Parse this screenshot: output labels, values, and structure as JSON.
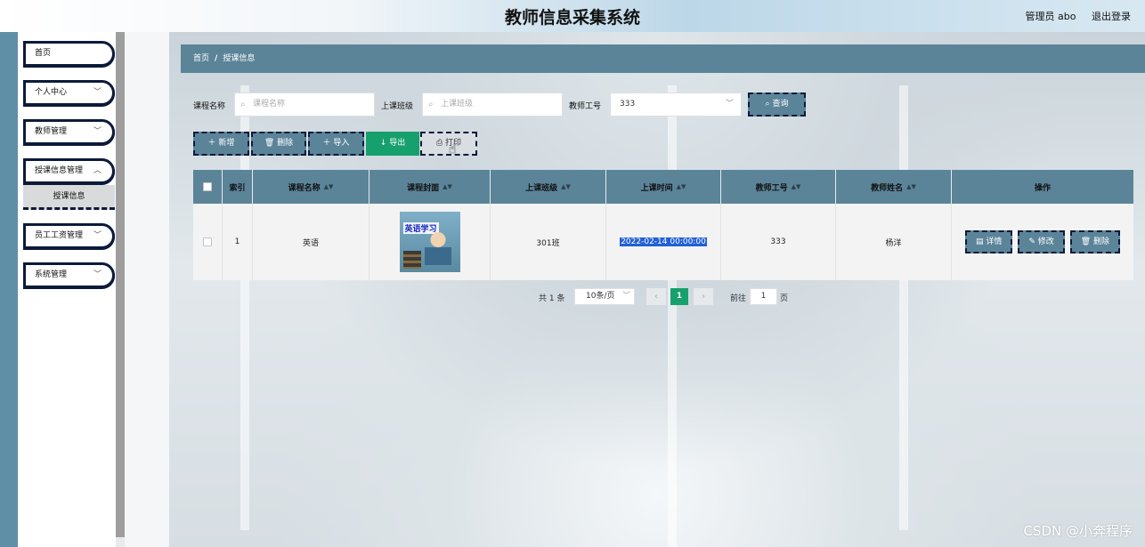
{
  "header": {
    "title": "教师信息采集系统",
    "user_label": "管理员 abo",
    "logout_label": "退出登录"
  },
  "sidebar": {
    "items": [
      {
        "label": "首页",
        "has_chevron": false
      },
      {
        "label": "个人中心",
        "has_chevron": true
      },
      {
        "label": "教师管理",
        "has_chevron": true
      },
      {
        "label": "授课信息管理",
        "has_chevron": true
      },
      {
        "label": "员工工资管理",
        "has_chevron": true
      },
      {
        "label": "系统管理",
        "has_chevron": true
      }
    ],
    "submenu_active": "授课信息"
  },
  "breadcrumb": {
    "home": "首页",
    "separator": "/",
    "current": "授课信息"
  },
  "search": {
    "course_name_label": "课程名称",
    "course_name_placeholder": "课程名称",
    "class_label": "上课班级",
    "class_placeholder": "上课班级",
    "teacher_id_label": "教师工号",
    "teacher_id_value": "333",
    "query_button": "查询"
  },
  "toolbar": {
    "add": "新增",
    "delete": "删除",
    "import": "导入",
    "export": "导出",
    "print": "打印"
  },
  "table": {
    "headers": {
      "index": "索引",
      "course_name": "课程名称",
      "course_cover": "课程封面",
      "class": "上课班级",
      "time": "上课时间",
      "teacher_id": "教师工号",
      "teacher_name": "教师姓名",
      "actions": "操作"
    },
    "rows": [
      {
        "index": "1",
        "course_name": "英语",
        "cover_text": "英语学习",
        "class": "301班",
        "time": "2022-02-14 00:00:00",
        "teacher_id": "333",
        "teacher_name": "杨洋"
      }
    ],
    "row_actions": {
      "detail": "详情",
      "edit": "修改",
      "delete": "删除"
    }
  },
  "pagination": {
    "total": "共 1 条",
    "page_size": "10条/页",
    "prev": "‹",
    "current_page": "1",
    "next": "›",
    "goto_label": "前往",
    "goto_value": "1",
    "page_unit": "页"
  },
  "watermark": "CSDN @小奔程序",
  "colors": {
    "primary": "#5b8499",
    "success": "#16a06e",
    "border_dashed": "#0c1a3a",
    "highlight": "#2160d6"
  }
}
